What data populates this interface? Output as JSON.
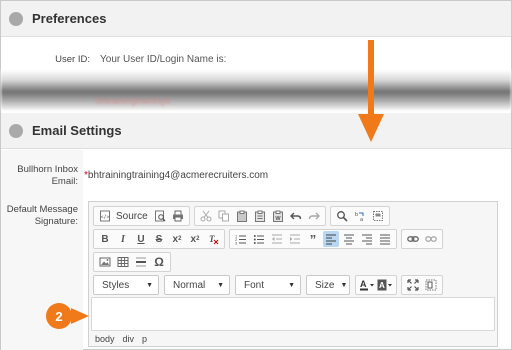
{
  "preferences": {
    "title": "Preferences",
    "user_id_label": "User ID:",
    "user_id_value": "Your User ID/Login Name is:",
    "faded_value": "bhtrainingtraining4"
  },
  "email_settings": {
    "title": "Email Settings",
    "inbox_label_line1": "Bullhorn Inbox",
    "inbox_label_line2": "Email:",
    "required_mark": "*",
    "inbox_email": "bhtrainingtraining4@acmerecruiters.com",
    "signature_label_line1": "Default Message",
    "signature_label_line2": "Signature:"
  },
  "editor": {
    "source_label": "Source",
    "styles_combo": "Styles",
    "format_combo": "Normal",
    "font_combo": "Font",
    "size_combo": "Size",
    "path": [
      "body",
      "div",
      "p"
    ]
  },
  "callout": {
    "number": "2"
  },
  "colors": {
    "accent_orange": "#f07a1a",
    "header_bg": "#f2f2f2",
    "required_red": "#d0021b"
  }
}
